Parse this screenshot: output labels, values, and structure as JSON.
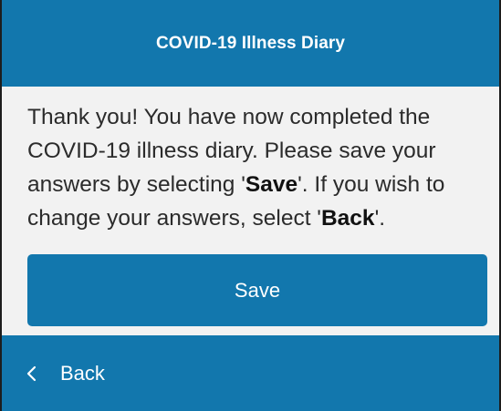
{
  "header": {
    "title": "COVID-19 Illness Diary"
  },
  "message": {
    "part1": "Thank you! You have now completed the COVID-19 illness diary. Please save your answers by selecting '",
    "save_word": "Save",
    "part2": "'. If you wish to change your answers, select '",
    "back_word": "Back",
    "part3": "'."
  },
  "buttons": {
    "save_label": "Save",
    "back_label": "Back"
  },
  "icons": {
    "back": "chevron-left-icon"
  },
  "colors": {
    "accent": "#1277ad",
    "background": "#f2f2f2",
    "text": "#2b2b2b"
  }
}
